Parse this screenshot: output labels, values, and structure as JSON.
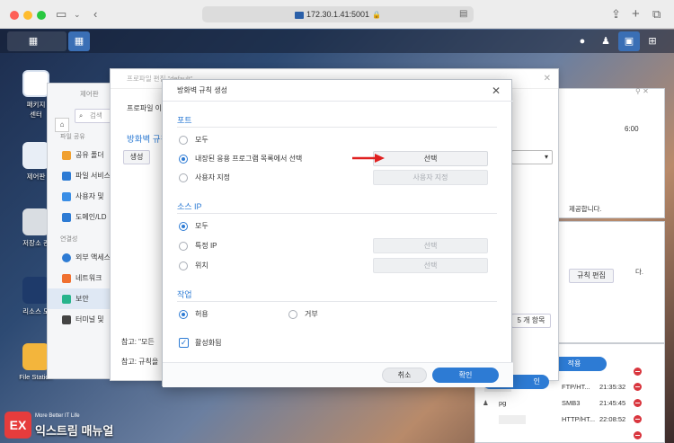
{
  "browser": {
    "address": "172.30.1.41:5001"
  },
  "desktop": {
    "icons": [
      {
        "label": "패키지\n센터"
      },
      {
        "label": "제어판"
      },
      {
        "label": "저장소 관"
      },
      {
        "label": "리소스 모"
      },
      {
        "label": "File Station"
      }
    ]
  },
  "control_panel": {
    "title": "제어판",
    "search_placeholder": "검색",
    "section_file": "파일 공유",
    "items_file": [
      "공유 폴더",
      "파일 서비스",
      "사용자 및",
      "도메인/LD"
    ],
    "section_conn": "연결성",
    "items_conn": [
      "외부 액세스",
      "네트워크",
      "보안",
      "터미널 및"
    ]
  },
  "profile_window": {
    "title": "프로파일 편집 \"default\"",
    "profile_label": "프로파일 이",
    "firewall_label": "방화벽 규칙",
    "create_btn": "생성",
    "count_text": "5 개 항목",
    "note1": "참고: \"모든 ",
    "note2": "참고: 규칙을 ",
    "rule_edit_btn": "규칙 편집"
  },
  "right_panel": {
    "time_text": "6:00",
    "provide_text": "제공합니다.",
    "d_text": "다.",
    "apply_btn": "적용",
    "confirm_btn": "인"
  },
  "log_rows": [
    {
      "name": "",
      "proto": "FTP/HT...",
      "time": "21:35:32"
    },
    {
      "name": "pg",
      "proto": "SMB3",
      "time": "21:45:45"
    },
    {
      "name": "",
      "proto": "HTTP/HT...",
      "time": "22:08:52"
    }
  ],
  "dialog": {
    "title": "방화벽 규칙 생성",
    "port": {
      "section": "포트",
      "options": [
        "모두",
        "내장된 응용 프로그램 목록에서 선택",
        "사용자 지정"
      ],
      "selected": 1,
      "select_btn": "선택",
      "custom_btn": "사용자 지정"
    },
    "source_ip": {
      "section": "소스 IP",
      "options": [
        "모두",
        "특정 IP",
        "위치"
      ],
      "selected": 0,
      "select_btn1": "선택",
      "select_btn2": "선택"
    },
    "action": {
      "section": "작업",
      "options": [
        "허용",
        "거부"
      ],
      "selected": 0
    },
    "enable_label": "활성화됨",
    "enabled": true,
    "cancel": "취소",
    "ok": "확인"
  },
  "watermark": {
    "sub": "More Better IT Life",
    "main": "익스트림 매뉴얼"
  },
  "colors": {
    "accent": "#2d7bd4",
    "arrow": "#e02020"
  }
}
